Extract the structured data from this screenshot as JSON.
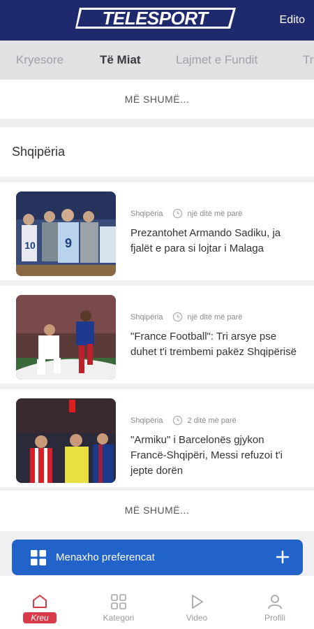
{
  "header": {
    "logo": "TELESPORT",
    "edito": "Edito"
  },
  "tabs": [
    {
      "label": "Kryesore",
      "active": false
    },
    {
      "label": "Të Miat",
      "active": true
    },
    {
      "label": "Lajmet e Fundit",
      "active": false
    },
    {
      "label": "Tr",
      "active": false
    }
  ],
  "more_top": "MË SHUMË...",
  "section": {
    "title": "Shqipëria",
    "articles": [
      {
        "category": "Shqipëria",
        "time": "një ditë më parë",
        "headline": "Prezantohet Armando Sadiku, ja fjalët e para si lojtar i Malaga"
      },
      {
        "category": "Shqipëria",
        "time": "një ditë më parë",
        "headline": "\"France Football\": Tri arsye pse duhet t'i trembemi pakëz Shqipërisë"
      },
      {
        "category": "Shqipëria",
        "time": "2 ditë më parë",
        "headline": "\"Armiku\" i Barcelonës gjykon Francë-Shqipëri, Messi refuzoi t'i jepte dorën"
      }
    ],
    "more": "MË SHUMË..."
  },
  "preferences": {
    "label": "Menaxho preferencat",
    "icon": "grid-icon"
  },
  "bottom_nav": [
    {
      "label": "Kreu",
      "icon": "home-icon",
      "active": true
    },
    {
      "label": "Kategori",
      "icon": "grid-icon",
      "active": false
    },
    {
      "label": "Video",
      "icon": "play-icon",
      "active": false
    },
    {
      "label": "Profili",
      "icon": "profile-icon",
      "active": false
    }
  ],
  "colors": {
    "header": "#1f2a6e",
    "accent_button": "#2163c9",
    "active_nav": "#d83a4a"
  }
}
